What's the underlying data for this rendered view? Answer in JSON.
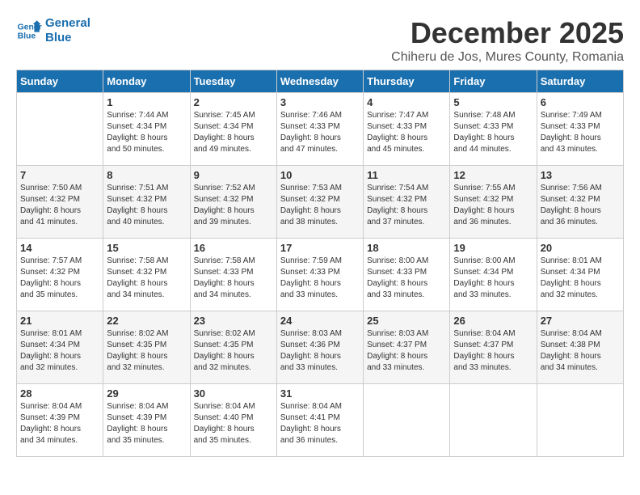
{
  "logo": {
    "line1": "General",
    "line2": "Blue"
  },
  "title": "December 2025",
  "subtitle": "Chiheru de Jos, Mures County, Romania",
  "weekdays": [
    "Sunday",
    "Monday",
    "Tuesday",
    "Wednesday",
    "Thursday",
    "Friday",
    "Saturday"
  ],
  "weeks": [
    [
      {
        "day": "",
        "info": ""
      },
      {
        "day": "1",
        "info": "Sunrise: 7:44 AM\nSunset: 4:34 PM\nDaylight: 8 hours\nand 50 minutes."
      },
      {
        "day": "2",
        "info": "Sunrise: 7:45 AM\nSunset: 4:34 PM\nDaylight: 8 hours\nand 49 minutes."
      },
      {
        "day": "3",
        "info": "Sunrise: 7:46 AM\nSunset: 4:33 PM\nDaylight: 8 hours\nand 47 minutes."
      },
      {
        "day": "4",
        "info": "Sunrise: 7:47 AM\nSunset: 4:33 PM\nDaylight: 8 hours\nand 45 minutes."
      },
      {
        "day": "5",
        "info": "Sunrise: 7:48 AM\nSunset: 4:33 PM\nDaylight: 8 hours\nand 44 minutes."
      },
      {
        "day": "6",
        "info": "Sunrise: 7:49 AM\nSunset: 4:33 PM\nDaylight: 8 hours\nand 43 minutes."
      }
    ],
    [
      {
        "day": "7",
        "info": "Sunrise: 7:50 AM\nSunset: 4:32 PM\nDaylight: 8 hours\nand 41 minutes."
      },
      {
        "day": "8",
        "info": "Sunrise: 7:51 AM\nSunset: 4:32 PM\nDaylight: 8 hours\nand 40 minutes."
      },
      {
        "day": "9",
        "info": "Sunrise: 7:52 AM\nSunset: 4:32 PM\nDaylight: 8 hours\nand 39 minutes."
      },
      {
        "day": "10",
        "info": "Sunrise: 7:53 AM\nSunset: 4:32 PM\nDaylight: 8 hours\nand 38 minutes."
      },
      {
        "day": "11",
        "info": "Sunrise: 7:54 AM\nSunset: 4:32 PM\nDaylight: 8 hours\nand 37 minutes."
      },
      {
        "day": "12",
        "info": "Sunrise: 7:55 AM\nSunset: 4:32 PM\nDaylight: 8 hours\nand 36 minutes."
      },
      {
        "day": "13",
        "info": "Sunrise: 7:56 AM\nSunset: 4:32 PM\nDaylight: 8 hours\nand 36 minutes."
      }
    ],
    [
      {
        "day": "14",
        "info": "Sunrise: 7:57 AM\nSunset: 4:32 PM\nDaylight: 8 hours\nand 35 minutes."
      },
      {
        "day": "15",
        "info": "Sunrise: 7:58 AM\nSunset: 4:32 PM\nDaylight: 8 hours\nand 34 minutes."
      },
      {
        "day": "16",
        "info": "Sunrise: 7:58 AM\nSunset: 4:33 PM\nDaylight: 8 hours\nand 34 minutes."
      },
      {
        "day": "17",
        "info": "Sunrise: 7:59 AM\nSunset: 4:33 PM\nDaylight: 8 hours\nand 33 minutes."
      },
      {
        "day": "18",
        "info": "Sunrise: 8:00 AM\nSunset: 4:33 PM\nDaylight: 8 hours\nand 33 minutes."
      },
      {
        "day": "19",
        "info": "Sunrise: 8:00 AM\nSunset: 4:34 PM\nDaylight: 8 hours\nand 33 minutes."
      },
      {
        "day": "20",
        "info": "Sunrise: 8:01 AM\nSunset: 4:34 PM\nDaylight: 8 hours\nand 32 minutes."
      }
    ],
    [
      {
        "day": "21",
        "info": "Sunrise: 8:01 AM\nSunset: 4:34 PM\nDaylight: 8 hours\nand 32 minutes."
      },
      {
        "day": "22",
        "info": "Sunrise: 8:02 AM\nSunset: 4:35 PM\nDaylight: 8 hours\nand 32 minutes."
      },
      {
        "day": "23",
        "info": "Sunrise: 8:02 AM\nSunset: 4:35 PM\nDaylight: 8 hours\nand 32 minutes."
      },
      {
        "day": "24",
        "info": "Sunrise: 8:03 AM\nSunset: 4:36 PM\nDaylight: 8 hours\nand 33 minutes."
      },
      {
        "day": "25",
        "info": "Sunrise: 8:03 AM\nSunset: 4:37 PM\nDaylight: 8 hours\nand 33 minutes."
      },
      {
        "day": "26",
        "info": "Sunrise: 8:04 AM\nSunset: 4:37 PM\nDaylight: 8 hours\nand 33 minutes."
      },
      {
        "day": "27",
        "info": "Sunrise: 8:04 AM\nSunset: 4:38 PM\nDaylight: 8 hours\nand 34 minutes."
      }
    ],
    [
      {
        "day": "28",
        "info": "Sunrise: 8:04 AM\nSunset: 4:39 PM\nDaylight: 8 hours\nand 34 minutes."
      },
      {
        "day": "29",
        "info": "Sunrise: 8:04 AM\nSunset: 4:39 PM\nDaylight: 8 hours\nand 35 minutes."
      },
      {
        "day": "30",
        "info": "Sunrise: 8:04 AM\nSunset: 4:40 PM\nDaylight: 8 hours\nand 35 minutes."
      },
      {
        "day": "31",
        "info": "Sunrise: 8:04 AM\nSunset: 4:41 PM\nDaylight: 8 hours\nand 36 minutes."
      },
      {
        "day": "",
        "info": ""
      },
      {
        "day": "",
        "info": ""
      },
      {
        "day": "",
        "info": ""
      }
    ]
  ]
}
